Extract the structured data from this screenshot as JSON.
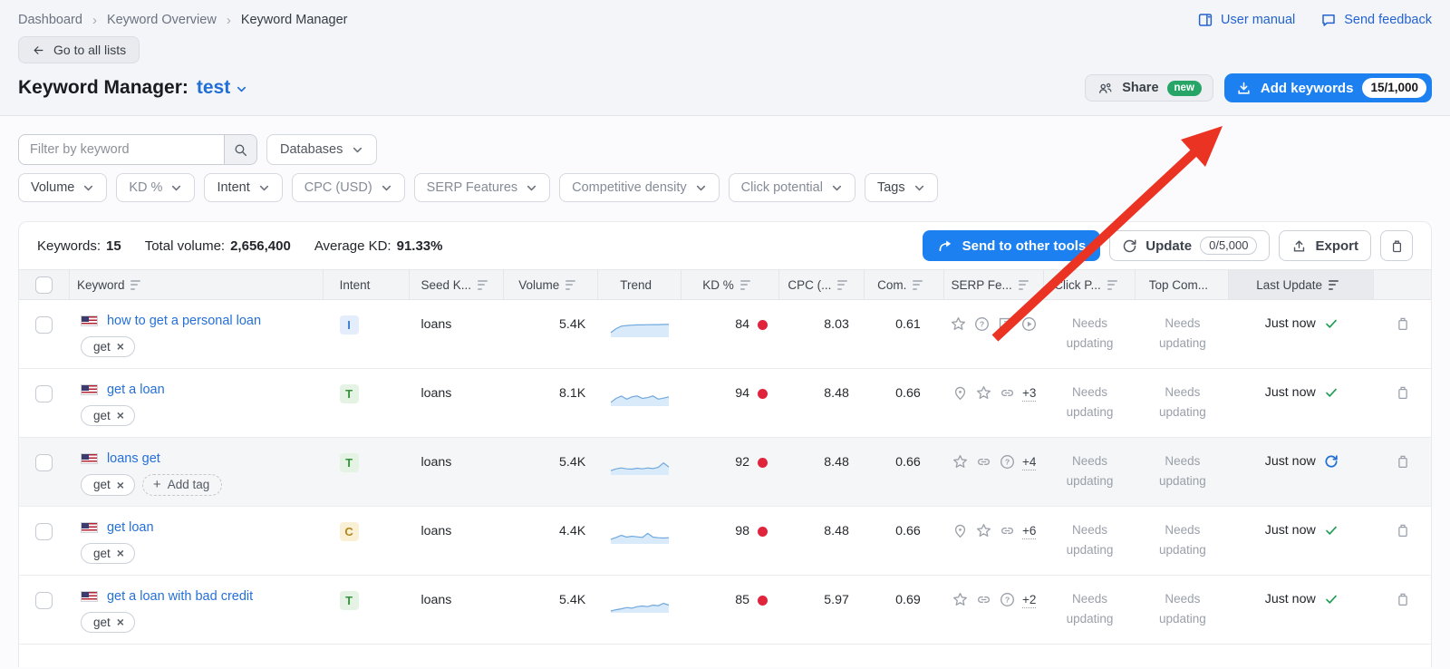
{
  "breadcrumb": {
    "items": [
      "Dashboard",
      "Keyword Overview",
      "Keyword Manager"
    ]
  },
  "header_links": {
    "user_manual": "User manual",
    "send_feedback": "Send feedback"
  },
  "back_button": {
    "label": "Go to all lists"
  },
  "title": {
    "label": "Keyword Manager:",
    "list_name": "test"
  },
  "header_actions": {
    "share_label": "Share",
    "share_badge": "new",
    "add_keywords_label": "Add keywords",
    "add_keywords_quota": "15/1,000"
  },
  "filters": {
    "keyword_placeholder": "Filter by keyword",
    "databases_label": "Databases",
    "pills": [
      {
        "label": "Volume",
        "muted": false
      },
      {
        "label": "KD %",
        "muted": true
      },
      {
        "label": "Intent",
        "muted": false
      },
      {
        "label": "CPC (USD)",
        "muted": true
      },
      {
        "label": "SERP Features",
        "muted": true
      },
      {
        "label": "Competitive density",
        "muted": true
      },
      {
        "label": "Click potential",
        "muted": true
      },
      {
        "label": "Tags",
        "muted": false
      }
    ]
  },
  "summary": {
    "keywords_label": "Keywords:",
    "keywords_value": "15",
    "volume_label": "Total volume:",
    "volume_value": "2,656,400",
    "kd_label": "Average KD:",
    "kd_value": "91.33%"
  },
  "toolbar": {
    "send_label": "Send to other tools",
    "update_label": "Update",
    "update_quota": "0/5,000",
    "export_label": "Export"
  },
  "table": {
    "columns": [
      {
        "key": "keyword",
        "label": "Keyword",
        "sort": true
      },
      {
        "key": "intent",
        "label": "Intent",
        "sort": false
      },
      {
        "key": "seed",
        "label": "Seed K...",
        "sort": true
      },
      {
        "key": "volume",
        "label": "Volume",
        "sort": true
      },
      {
        "key": "trend",
        "label": "Trend",
        "sort": false
      },
      {
        "key": "kd",
        "label": "KD %",
        "sort": true
      },
      {
        "key": "cpc",
        "label": "CPC (...",
        "sort": true
      },
      {
        "key": "com",
        "label": "Com.",
        "sort": true
      },
      {
        "key": "serp",
        "label": "SERP Fe...",
        "sort": true
      },
      {
        "key": "click",
        "label": "Click P...",
        "sort": true
      },
      {
        "key": "top",
        "label": "Top Com...",
        "sort": false
      },
      {
        "key": "last",
        "label": "Last Update",
        "sort": true,
        "active": true
      }
    ],
    "rows": [
      {
        "keyword": "how to get a personal loan",
        "flag": "us",
        "tags": [
          "get"
        ],
        "add_tag": false,
        "intent": "I",
        "seed": "loans",
        "volume": "5.4K",
        "trend": [
          0.3,
          0.55,
          0.72,
          0.76,
          0.78,
          0.8,
          0.8,
          0.81,
          0.82,
          0.82,
          0.83,
          0.83
        ],
        "kd": "84",
        "cpc": "8.03",
        "com": "0.61",
        "serp_icons": [
          "star",
          "question-circle",
          "chat-question",
          "play-circle"
        ],
        "serp_more": "",
        "click_potential": "Needs updating",
        "top_competitors": "Needs updating",
        "last_update": "Just now",
        "last_icon": "check",
        "highlighted": false
      },
      {
        "keyword": "get a loan",
        "flag": "us",
        "tags": [
          "get"
        ],
        "add_tag": false,
        "intent": "T",
        "seed": "loans",
        "volume": "8.1K",
        "trend": [
          0.25,
          0.5,
          0.65,
          0.45,
          0.6,
          0.66,
          0.5,
          0.55,
          0.66,
          0.45,
          0.52,
          0.6
        ],
        "kd": "94",
        "cpc": "8.48",
        "com": "0.66",
        "serp_icons": [
          "pin",
          "star",
          "link"
        ],
        "serp_more": "+3",
        "click_potential": "Needs updating",
        "top_competitors": "Needs updating",
        "last_update": "Just now",
        "last_icon": "check",
        "highlighted": false
      },
      {
        "keyword": "loans get",
        "flag": "us",
        "tags": [
          "get"
        ],
        "add_tag": true,
        "intent": "T",
        "seed": "loans",
        "volume": "5.4K",
        "trend": [
          0.28,
          0.4,
          0.46,
          0.4,
          0.38,
          0.44,
          0.4,
          0.46,
          0.42,
          0.5,
          0.78,
          0.52
        ],
        "kd": "92",
        "cpc": "8.48",
        "com": "0.66",
        "serp_icons": [
          "star",
          "link",
          "question-circle"
        ],
        "serp_more": "+4",
        "click_potential": "Needs updating",
        "top_competitors": "Needs updating",
        "last_update": "Just now",
        "last_icon": "refresh",
        "highlighted": true
      },
      {
        "keyword": "get loan",
        "flag": "us",
        "tags": [
          "get"
        ],
        "add_tag": false,
        "intent": "C",
        "seed": "loans",
        "volume": "4.4K",
        "trend": [
          0.3,
          0.42,
          0.56,
          0.44,
          0.5,
          0.46,
          0.42,
          0.68,
          0.44,
          0.4,
          0.38,
          0.4
        ],
        "kd": "98",
        "cpc": "8.48",
        "com": "0.66",
        "serp_icons": [
          "pin",
          "star",
          "link"
        ],
        "serp_more": "+6",
        "click_potential": "Needs updating",
        "top_competitors": "Needs updating",
        "last_update": "Just now",
        "last_icon": "check",
        "highlighted": false
      },
      {
        "keyword": "get a loan with bad credit",
        "flag": "us",
        "tags": [
          "get"
        ],
        "add_tag": false,
        "intent": "T",
        "seed": "loans",
        "volume": "5.4K",
        "trend": [
          0.12,
          0.2,
          0.26,
          0.34,
          0.3,
          0.4,
          0.44,
          0.4,
          0.5,
          0.46,
          0.62,
          0.5
        ],
        "kd": "85",
        "cpc": "5.97",
        "com": "0.69",
        "serp_icons": [
          "star",
          "link",
          "question-circle"
        ],
        "serp_more": "+2",
        "click_potential": "Needs updating",
        "top_competitors": "Needs updating",
        "last_update": "Just now",
        "last_icon": "check",
        "highlighted": false
      }
    ]
  },
  "intent_styles": {
    "I": {
      "bg": "#e3edfb",
      "fg": "#3b7cd7"
    },
    "T": {
      "bg": "#e5f3e5",
      "fg": "#37913e"
    },
    "C": {
      "bg": "#faf0d6",
      "fg": "#b2861e"
    }
  },
  "colors": {
    "primary_blue": "#1d80f0",
    "link_blue": "#2470d8",
    "kd_dot_red": "#e0243c",
    "check_green": "#1d9e50",
    "refresh_blue": "#1f6fd6",
    "new_badge_green": "#27a567",
    "arrow_red": "#ea3323"
  },
  "tag_remove_icon": "×",
  "add_tag_label": "Add tag"
}
